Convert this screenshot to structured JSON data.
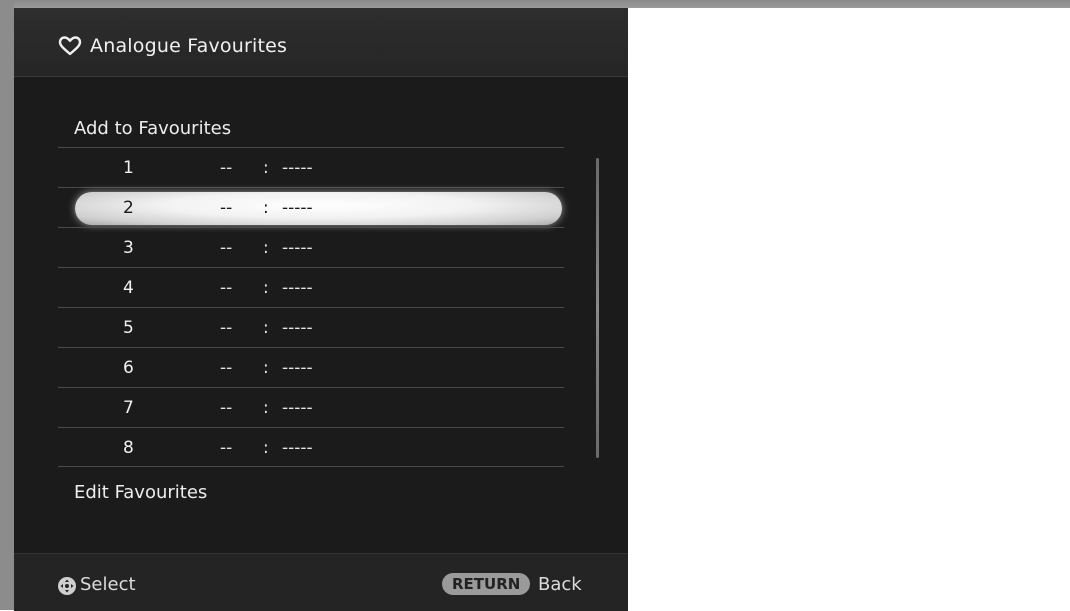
{
  "header": {
    "icon": "heart-icon",
    "title": "Analogue Favourites"
  },
  "sections": {
    "add_label": "Add to Favourites",
    "edit_label": "Edit Favourites"
  },
  "favourites": [
    {
      "number": "1",
      "channel": "--",
      "name": "-----",
      "selected": false
    },
    {
      "number": "2",
      "channel": "--",
      "name": "-----",
      "selected": true
    },
    {
      "number": "3",
      "channel": "--",
      "name": "-----",
      "selected": false
    },
    {
      "number": "4",
      "channel": "--",
      "name": "-----",
      "selected": false
    },
    {
      "number": "5",
      "channel": "--",
      "name": "-----",
      "selected": false
    },
    {
      "number": "6",
      "channel": "--",
      "name": "-----",
      "selected": false
    },
    {
      "number": "7",
      "channel": "--",
      "name": "-----",
      "selected": false
    },
    {
      "number": "8",
      "channel": "--",
      "name": "-----",
      "selected": false
    }
  ],
  "separator": ":",
  "footer": {
    "select_icon": "dpad-icon",
    "select_label": "Select",
    "return_key": "RETURN",
    "back_label": "Back"
  },
  "colors": {
    "panel": "#1b1b1b",
    "highlight": "#f2f2f2",
    "text": "#eaeaea"
  }
}
